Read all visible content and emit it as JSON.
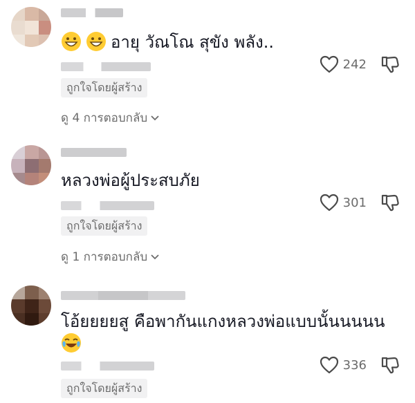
{
  "comments": [
    {
      "text": "อายุ วัณโณ สุขัง พลัง..",
      "emoji": [
        "grin-emoji",
        "grin-emoji"
      ],
      "likes": "242",
      "creator_liked": "ถูกใจโดยผู้สร้าง",
      "replies": "ดู 4 การตอบกลับ"
    },
    {
      "text": "หลวงพ่อผู้ประสบภัย",
      "likes": "301",
      "creator_liked": "ถูกใจโดยผู้สร้าง",
      "replies": "ดู 1 การตอบกลับ"
    },
    {
      "text": "โอ้ยยยยสู คือพากันแกงหลวงพ่อแบบนั้นนนนน",
      "emoji_after": "tears-of-joy-emoji",
      "likes": "336",
      "creator_liked": "ถูกใจโดยผู้สร้าง"
    }
  ],
  "icons": {
    "like": "heart-outline-icon",
    "dislike": "thumbs-down-icon",
    "expand": "chevron-down-icon"
  },
  "colors": {
    "text": "#161823",
    "muted": "#6b6b6b",
    "badge_bg": "#f1f1f2"
  }
}
